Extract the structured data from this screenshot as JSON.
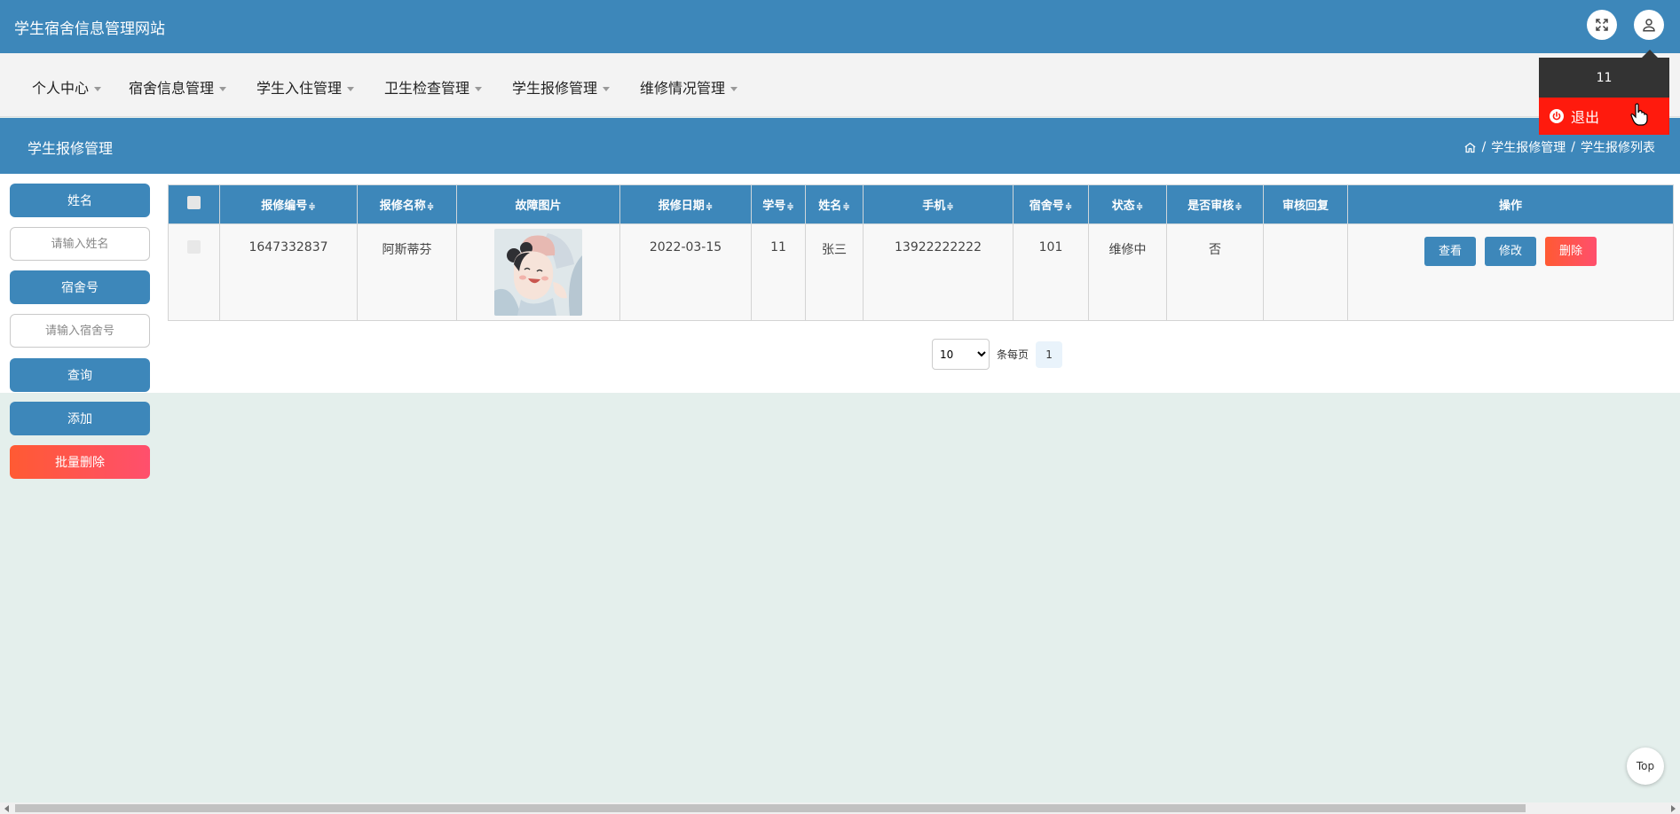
{
  "header": {
    "site_title": "学生宿舍信息管理网站"
  },
  "nav": {
    "items": [
      {
        "label": "个人中心"
      },
      {
        "label": "宿舍信息管理"
      },
      {
        "label": "学生入住管理"
      },
      {
        "label": "卫生检查管理"
      },
      {
        "label": "学生报修管理"
      },
      {
        "label": "维修情况管理"
      }
    ]
  },
  "user_menu": {
    "username": "11",
    "logout_label": "退出"
  },
  "page": {
    "title": "学生报修管理",
    "breadcrumb": [
      "学生报修管理",
      "学生报修列表"
    ],
    "breadcrumb_sep": "/"
  },
  "sidebar": {
    "name_label": "姓名",
    "name_placeholder": "请输入姓名",
    "dorm_label": "宿舍号",
    "dorm_placeholder": "请输入宿舍号",
    "query_button": "查询",
    "add_button": "添加",
    "batch_delete_button": "批量删除"
  },
  "table": {
    "columns": [
      "报修编号",
      "报修名称",
      "故障图片",
      "报修日期",
      "学号",
      "姓名",
      "手机",
      "宿舍号",
      "状态",
      "是否审核",
      "审核回复",
      "操作"
    ],
    "sortable_marker": "≑",
    "rows": [
      {
        "repair_no": "1647332837",
        "repair_name": "阿斯蒂芬",
        "image": "illustration-girl",
        "date": "2022-03-15",
        "student_no": "11",
        "name": "张三",
        "phone": "13922222222",
        "dorm": "101",
        "status": "维修中",
        "reviewed": "否",
        "reply": ""
      }
    ],
    "actions": {
      "view": "查看",
      "edit": "修改",
      "delete": "删除"
    }
  },
  "pagination": {
    "page_size": "10",
    "page_size_options": [
      "10"
    ],
    "per_page_label": "条每页",
    "current_page": "1"
  },
  "back_to_top": "Top",
  "colors": {
    "primary": "#3d87ba",
    "danger_gradient_start": "#ff5a33",
    "danger_gradient_end": "#ff4f6d",
    "logout_red": "#ff1a0d",
    "page_background": "#e4efec"
  }
}
